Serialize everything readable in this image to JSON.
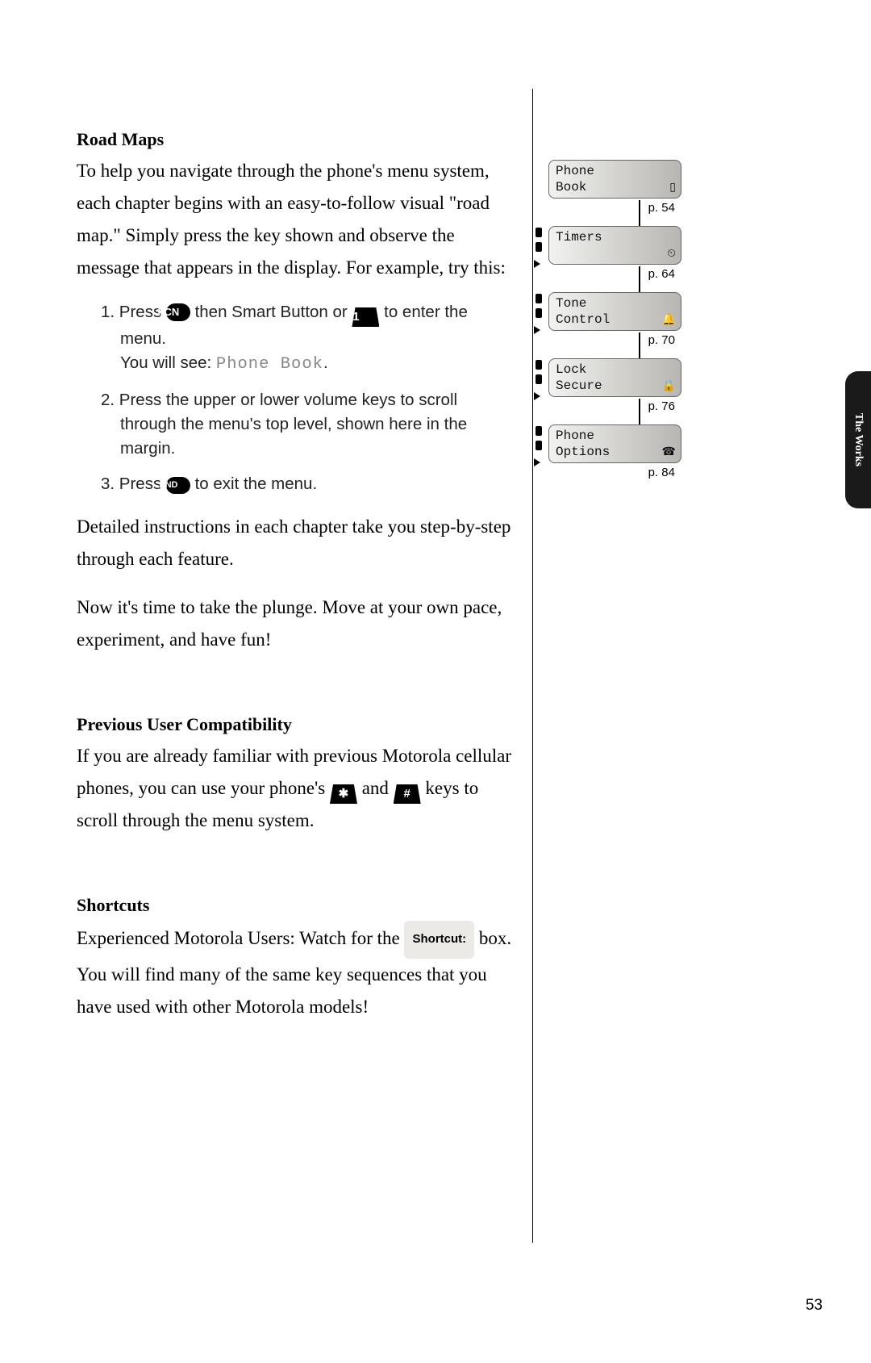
{
  "headings": {
    "road_maps": "Road Maps",
    "prev_compat": "Previous User Compatibility",
    "shortcuts": "Shortcuts"
  },
  "paragraphs": {
    "road_maps_intro": "To help you navigate through the phone's menu system, each chapter begins with an easy-to-follow visual \"road map.\" Simply press the key shown and observe the message that appears in the display. For example, try this:",
    "detailed": "Detailed instructions in each chapter take you step-by-step through each feature.",
    "plunge": "Now it's time to take the plunge. Move at your own pace, experiment, and have fun!",
    "compat_pre": "If you are already familiar with previous Motorola cellular phones, you can use your phone's ",
    "compat_mid": " and ",
    "compat_post": " keys to scroll through the menu system.",
    "shortcuts_pre": "Experienced Motorola Users: Watch for the ",
    "shortcuts_post": " box. You will find many of the same key sequences that you have used with other Motorola models!"
  },
  "steps": {
    "s1_a": "1. Press ",
    "s1_b": " then Smart Button or ",
    "s1_c": " to enter the menu.",
    "s1_d": "You will see: ",
    "s1_lcd": "Phone Book",
    "s2": "2. Press the upper or lower volume keys to scroll through the menu's top level, shown here in the margin.",
    "s3_a": "3. Press ",
    "s3_b": " to exit the menu."
  },
  "keys": {
    "fcn": "FCN",
    "one": "1",
    "end": "END",
    "star": "✱",
    "hash": "#"
  },
  "shortcut_label": "Shortcut:",
  "side_tab": "The Works",
  "page_number": "53",
  "menu_items": [
    {
      "line1": "Phone",
      "line2": "Book",
      "icon": "▯",
      "pref": "p. 54"
    },
    {
      "line1": "Timers",
      "line2": "",
      "icon": "⏲",
      "pref": "p. 64"
    },
    {
      "line1": "Tone",
      "line2": "Control",
      "icon": "🔔",
      "pref": "p. 70"
    },
    {
      "line1": "Lock",
      "line2": "Secure",
      "icon": "🔒",
      "pref": "p. 76"
    },
    {
      "line1": "Phone",
      "line2": "Options",
      "icon": "☎",
      "pref": "p. 84"
    }
  ]
}
